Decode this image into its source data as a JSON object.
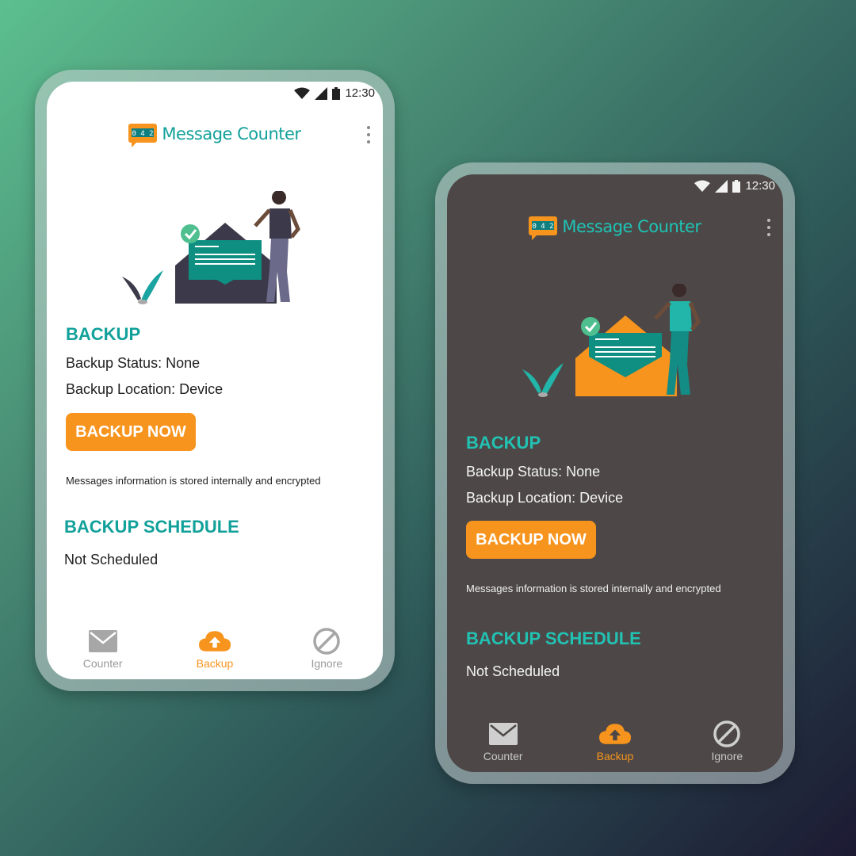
{
  "status_bar": {
    "time": "12:30"
  },
  "app": {
    "title": "Message Counter",
    "logo_digits": "0 4 2"
  },
  "backup": {
    "heading": "BACKUP",
    "status_line": "Backup Status: None",
    "location_line": "Backup Location: Device",
    "button_label": "BACKUP NOW",
    "note": "Messages information is stored internally and encrypted"
  },
  "schedule": {
    "heading": "BACKUP SCHEDULE",
    "value": "Not Scheduled"
  },
  "nav": {
    "items": [
      {
        "label": "Counter",
        "icon": "envelope-icon",
        "active": false
      },
      {
        "label": "Backup",
        "icon": "cloud-upload-icon",
        "active": true
      },
      {
        "label": "Ignore",
        "icon": "block-icon",
        "active": false
      }
    ]
  },
  "colors": {
    "accent": "#12a19a",
    "button": "#f7941d",
    "light_screen": "#ffffff",
    "dark_screen": "#4d4847"
  }
}
